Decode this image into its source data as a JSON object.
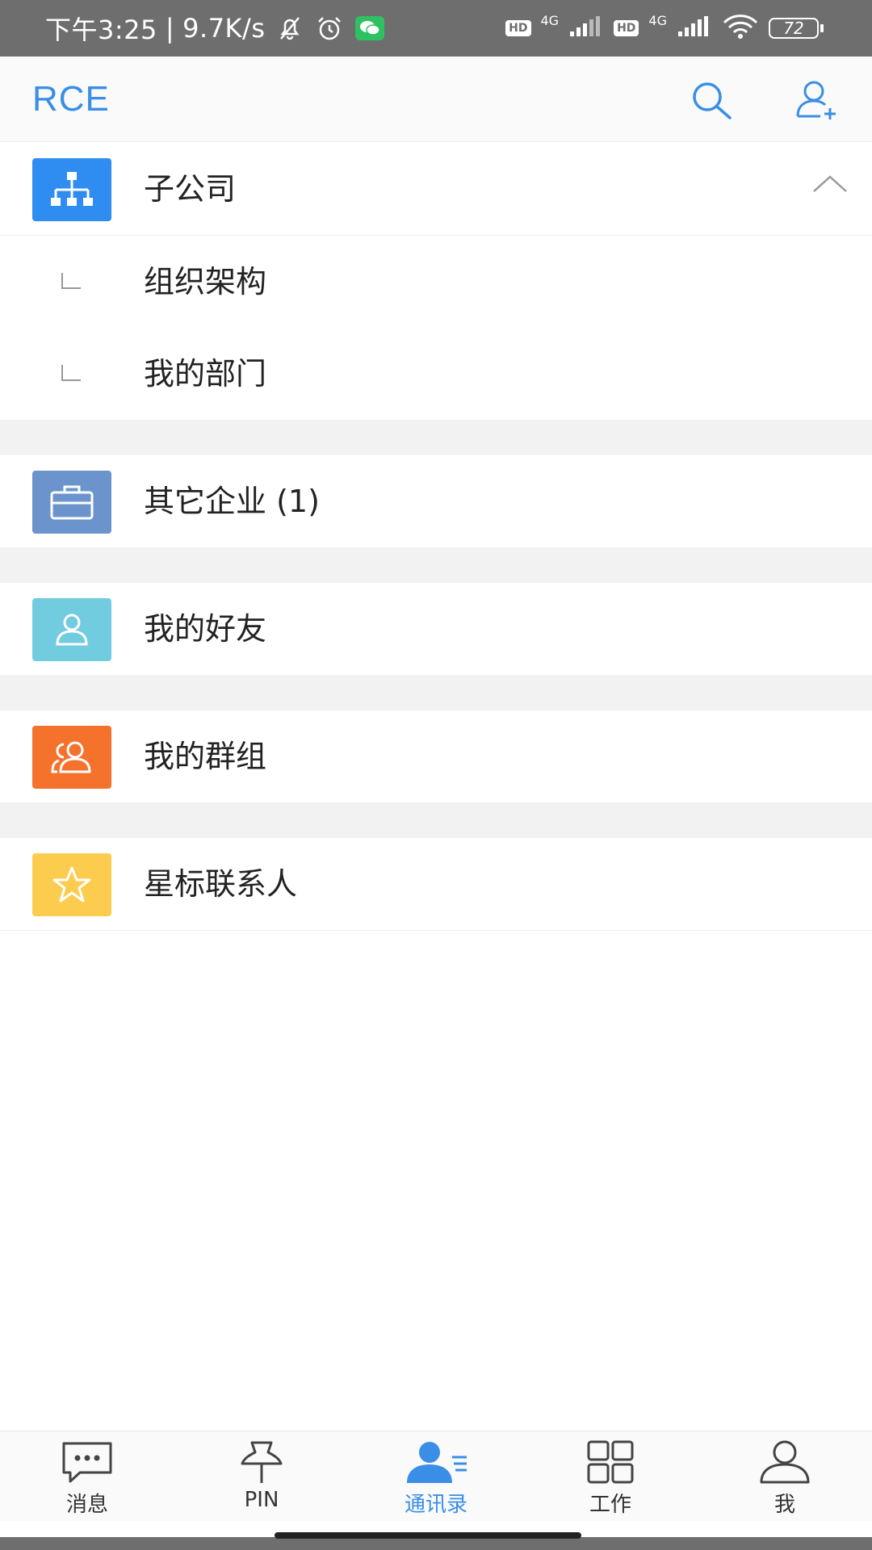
{
  "status_bar": {
    "time": "下午3:25",
    "separator": "|",
    "speed": "9.7K/s",
    "sim1_badge": "HD",
    "sim1_net": "4G",
    "sim2_badge": "HD",
    "sim2_net": "4G",
    "battery": "72"
  },
  "header": {
    "title": "RCE",
    "search_icon": "search-icon",
    "add_contact_icon": "add-contact-icon",
    "accent": "#3a8ee6"
  },
  "contacts": {
    "subsidiary": {
      "label": "子公司",
      "icon": "org-chart-icon",
      "color": "#2f8cf0",
      "expanded": true
    },
    "sub_items": [
      {
        "label": "组织架构"
      },
      {
        "label": "我的部门"
      }
    ],
    "other_companies": {
      "label": "其它企业 (1)",
      "icon": "briefcase-icon",
      "color": "#6b94cc"
    },
    "my_friends": {
      "label": "我的好友",
      "icon": "person-icon",
      "color": "#72cce0"
    },
    "my_groups": {
      "label": "我的群组",
      "icon": "group-icon",
      "color": "#f4722b"
    },
    "starred": {
      "label": "星标联系人",
      "icon": "star-icon",
      "color": "#fccc4e"
    }
  },
  "bottom_nav": {
    "items": [
      {
        "label": "消息",
        "icon": "chat-bubble-icon"
      },
      {
        "label": "PIN",
        "icon": "pushpin-icon"
      },
      {
        "label": "通讯录",
        "icon": "contacts-icon",
        "active": true
      },
      {
        "label": "工作",
        "icon": "grid-icon"
      },
      {
        "label": "我",
        "icon": "profile-icon"
      }
    ]
  }
}
